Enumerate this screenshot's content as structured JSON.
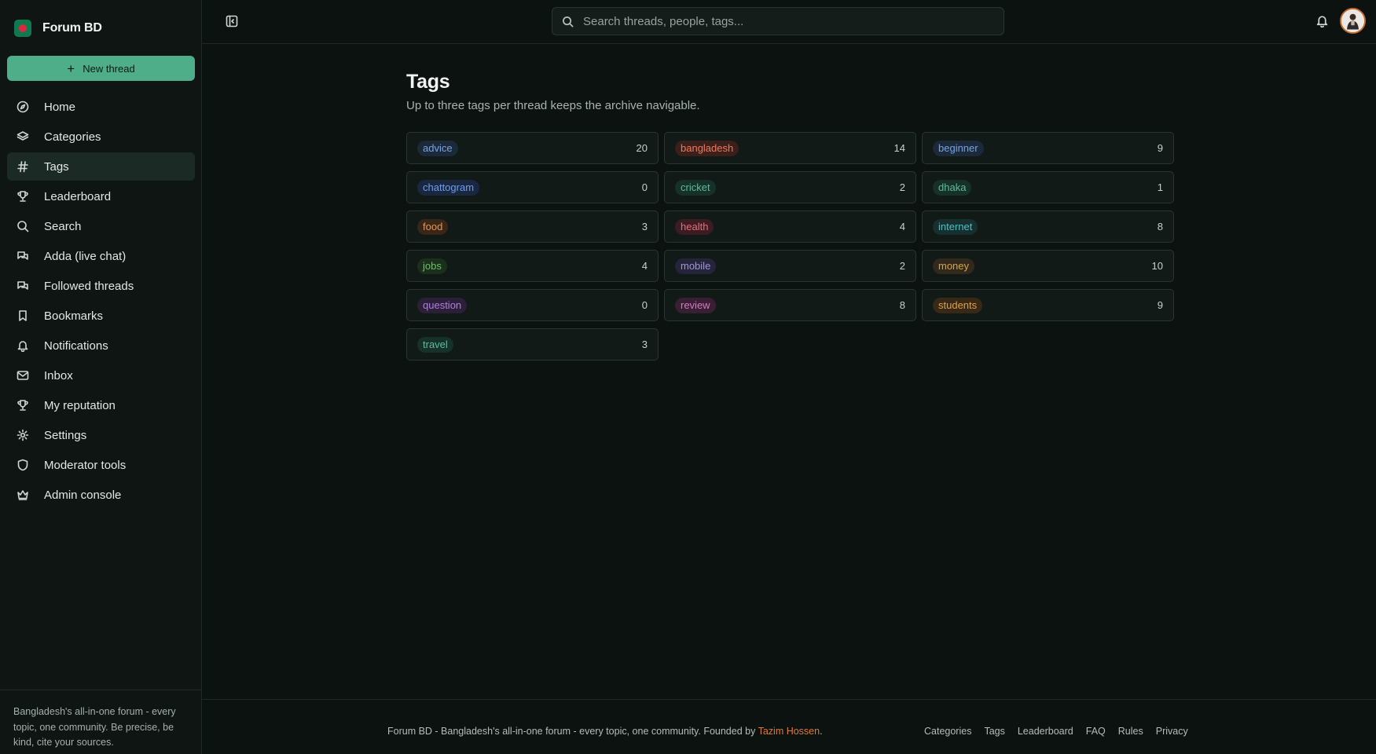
{
  "brand": {
    "name": "Forum BD"
  },
  "new_thread_label": "New thread",
  "nav": [
    {
      "label": "Home",
      "icon": "compass-icon",
      "active": false
    },
    {
      "label": "Categories",
      "icon": "layers-icon",
      "active": false
    },
    {
      "label": "Tags",
      "icon": "hash-icon",
      "active": true
    },
    {
      "label": "Leaderboard",
      "icon": "trophy-icon",
      "active": false
    },
    {
      "label": "Search",
      "icon": "search-icon",
      "active": false
    },
    {
      "label": "Adda (live chat)",
      "icon": "chat-icon",
      "active": false
    },
    {
      "label": "Followed threads",
      "icon": "chat-icon",
      "active": false
    },
    {
      "label": "Bookmarks",
      "icon": "bookmark-icon",
      "active": false
    },
    {
      "label": "Notifications",
      "icon": "bell-icon",
      "active": false
    },
    {
      "label": "Inbox",
      "icon": "mail-icon",
      "active": false
    },
    {
      "label": "My reputation",
      "icon": "trophy-icon",
      "active": false
    },
    {
      "label": "Settings",
      "icon": "gear-icon",
      "active": false
    },
    {
      "label": "Moderator tools",
      "icon": "shield-icon",
      "active": false
    },
    {
      "label": "Admin console",
      "icon": "crown-icon",
      "active": false
    }
  ],
  "sidebar_footer": "Bangladesh's all-in-one forum - every topic, one community. Be precise, be kind, cite your sources.",
  "search": {
    "placeholder": "Search threads, people, tags..."
  },
  "page": {
    "title": "Tags",
    "subtitle": "Up to three tags per thread keeps the archive navigable."
  },
  "tags": [
    {
      "name": "advice",
      "count": "20",
      "color": "#7aa2e0",
      "bg": "#1b2a3a"
    },
    {
      "name": "bangladesh",
      "count": "14",
      "color": "#ef7a5c",
      "bg": "#3a1f1a"
    },
    {
      "name": "beginner",
      "count": "9",
      "color": "#7aa2e0",
      "bg": "#1b2a3a"
    },
    {
      "name": "chattogram",
      "count": "0",
      "color": "#6f9ee8",
      "bg": "#1a2740"
    },
    {
      "name": "cricket",
      "count": "2",
      "color": "#5ebd96",
      "bg": "#16302a"
    },
    {
      "name": "dhaka",
      "count": "1",
      "color": "#5ebd96",
      "bg": "#16302a"
    },
    {
      "name": "food",
      "count": "3",
      "color": "#e8954e",
      "bg": "#3a2616"
    },
    {
      "name": "health",
      "count": "4",
      "color": "#e86e7e",
      "bg": "#3a1c22"
    },
    {
      "name": "internet",
      "count": "8",
      "color": "#4fbfc4",
      "bg": "#15302f"
    },
    {
      "name": "jobs",
      "count": "4",
      "color": "#6cc06a",
      "bg": "#1b301a"
    },
    {
      "name": "mobile",
      "count": "2",
      "color": "#9e98d8",
      "bg": "#25243a"
    },
    {
      "name": "money",
      "count": "10",
      "color": "#d0a64a",
      "bg": "#33291a"
    },
    {
      "name": "question",
      "count": "0",
      "color": "#b37de0",
      "bg": "#2c1f3a"
    },
    {
      "name": "review",
      "count": "8",
      "color": "#d77ac4",
      "bg": "#381f34"
    },
    {
      "name": "students",
      "count": "9",
      "color": "#e0a048",
      "bg": "#382816"
    },
    {
      "name": "travel",
      "count": "3",
      "color": "#5ebd96",
      "bg": "#16302a"
    }
  ],
  "footer": {
    "text": "Forum BD - Bangladesh's all-in-one forum - every topic, one community. Founded by ",
    "founder": "Tazim Hossen",
    "suffix": ".",
    "links": [
      "Categories",
      "Tags",
      "Leaderboard",
      "FAQ",
      "Rules",
      "Privacy"
    ]
  }
}
